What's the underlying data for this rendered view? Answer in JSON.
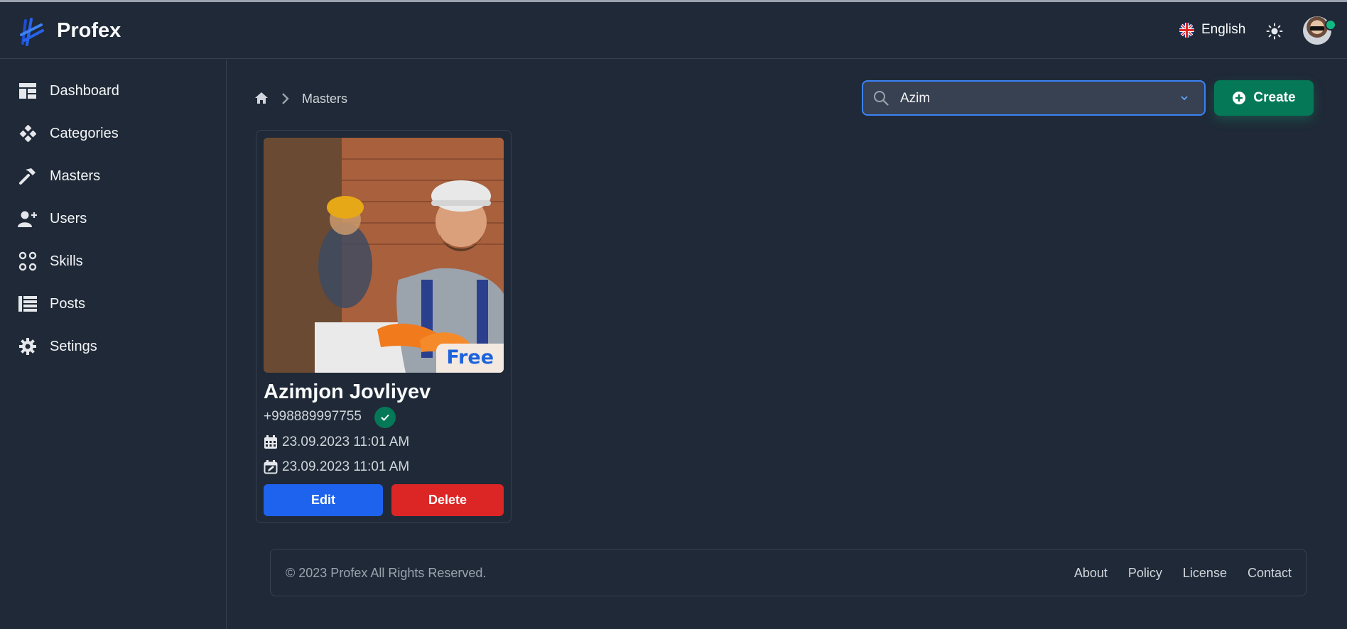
{
  "app": {
    "name": "Profex"
  },
  "header": {
    "language": "English",
    "language_flag_icon": "uk-flag-icon",
    "theme_icon": "sun-icon"
  },
  "sidebar": {
    "items": [
      {
        "label": "Dashboard",
        "icon": "dashboard-icon"
      },
      {
        "label": "Categories",
        "icon": "categories-icon"
      },
      {
        "label": "Masters",
        "icon": "hammer-icon"
      },
      {
        "label": "Users",
        "icon": "add-user-icon"
      },
      {
        "label": "Skills",
        "icon": "skills-icon"
      },
      {
        "label": "Posts",
        "icon": "list-icon"
      },
      {
        "label": "Setings",
        "icon": "gear-icon"
      }
    ]
  },
  "breadcrumb": {
    "current": "Masters"
  },
  "search": {
    "value": "Azim"
  },
  "actions": {
    "create_label": "Create"
  },
  "master_card": {
    "badge": "Free",
    "name": "Azimjon Jovliyev",
    "phone": "+998889997755",
    "created": "23.09.2023 11:01 AM",
    "updated": "23.09.2023 11:01 AM",
    "edit_label": "Edit",
    "delete_label": "Delete"
  },
  "footer": {
    "copyright": "© 2023 Profex All Rights Reserved.",
    "links": [
      "About",
      "Policy",
      "License",
      "Contact"
    ]
  },
  "colors": {
    "background": "#1f2937",
    "accent_blue": "#1d63ed",
    "accent_green": "#047857",
    "danger_red": "#dc2626"
  }
}
